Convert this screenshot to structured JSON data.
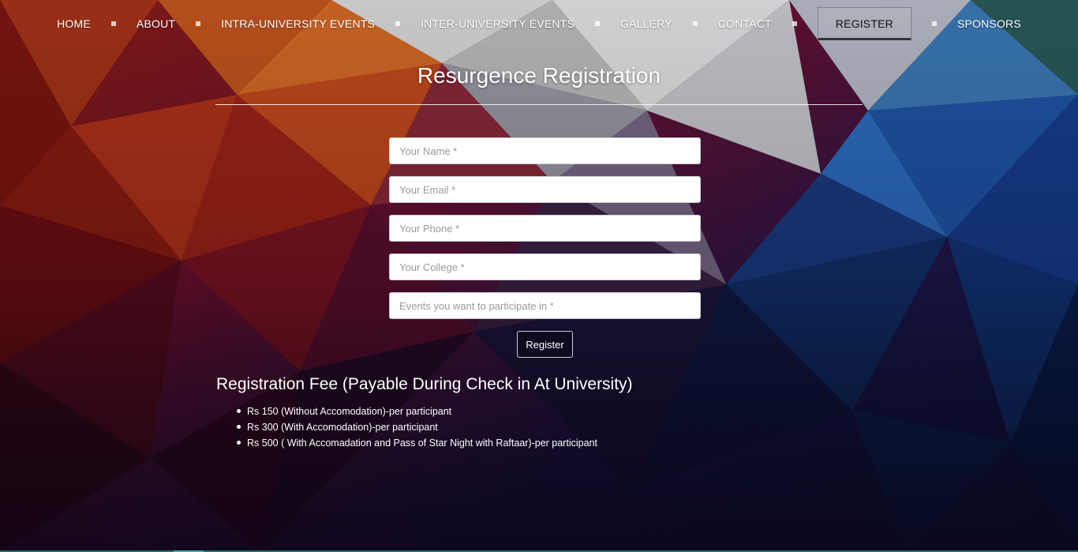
{
  "nav": {
    "items": [
      {
        "label": "HOME"
      },
      {
        "label": "ABOUT"
      },
      {
        "label": "INTRA-UNIVERSITY EVENTS"
      },
      {
        "label": "INTER-UNIVERSITY EVENTS"
      },
      {
        "label": "GALLERY"
      },
      {
        "label": "CONTACT"
      },
      {
        "label": "REGISTER",
        "active": true
      },
      {
        "label": "SPONSORS"
      }
    ]
  },
  "page": {
    "title": "Resurgence Registration"
  },
  "form": {
    "name_placeholder": "Your Name *",
    "email_placeholder": "Your Email *",
    "phone_placeholder": "Your Phone *",
    "college_placeholder": "Your College *",
    "events_placeholder": "Events you want to participate in *",
    "submit_label": "Register"
  },
  "fees": {
    "title": "Registration Fee (Payable During Check in At University)",
    "items": [
      "Rs 150 (Without Accomodation)-per participant",
      "Rs 300 (With Accomodation)-per participant",
      "Rs 500 ( With Accomadation and Pass of Star Night with Raftaar)-per participant"
    ]
  },
  "colors": {
    "active_nav_text": "#111111",
    "rule": "#ffffff"
  }
}
